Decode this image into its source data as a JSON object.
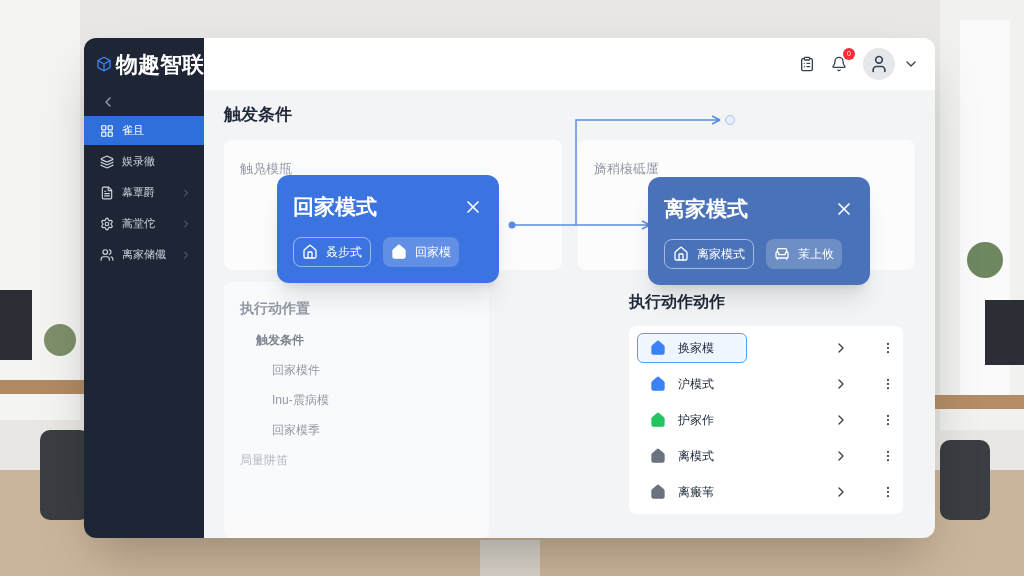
{
  "app": {
    "logo": "物趣智联"
  },
  "header": {
    "notification_count": "0"
  },
  "sidebar": {
    "items": [
      {
        "label": "雀且",
        "selected": true,
        "expandable": false
      },
      {
        "label": "娱录徹",
        "selected": false,
        "expandable": false
      },
      {
        "label": "幕覃爵",
        "selected": false,
        "expandable": true
      },
      {
        "label": "蒿堂佗",
        "selected": false,
        "expandable": true
      },
      {
        "label": "离家储儎",
        "selected": false,
        "expandable": true
      }
    ]
  },
  "trigger": {
    "title": "触发条件",
    "cards": [
      {
        "label": "触凫模甁"
      },
      {
        "label": "旖稍榱砥厪"
      }
    ]
  },
  "mode_cards": [
    {
      "title": "回家模式",
      "actions": [
        {
          "label": "叒步式",
          "kind": "outline"
        },
        {
          "label": "回家模",
          "kind": "filled"
        }
      ]
    },
    {
      "title": "离家模式",
      "actions": [
        {
          "label": "离家模式",
          "kind": "outline"
        },
        {
          "label": "茉上攸",
          "kind": "seat"
        }
      ]
    }
  ],
  "left_panel": {
    "title": "执行动作置",
    "group": "触发条件",
    "items": [
      {
        "label": "回家模件"
      },
      {
        "label": "Inu-震病模"
      },
      {
        "label": "回家模季"
      }
    ],
    "footer": "局量阱笛"
  },
  "right_panel": {
    "title": "执行动作动作",
    "items": [
      {
        "label": "换家模",
        "selected": true,
        "color": "#3b82f6"
      },
      {
        "label": "沪模式",
        "selected": false,
        "color": "#3b82f6"
      },
      {
        "label": "护家作",
        "selected": false,
        "color": "#22c55e"
      },
      {
        "label": "离模式",
        "selected": false,
        "color": "#6b7280"
      },
      {
        "label": "离瘢苇",
        "selected": false,
        "color": "#6b7280"
      }
    ]
  }
}
